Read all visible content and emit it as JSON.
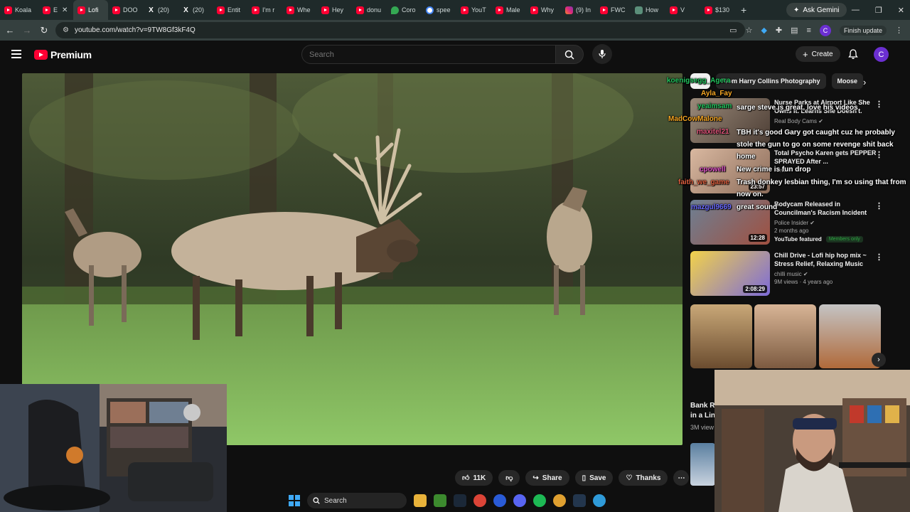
{
  "browser": {
    "tabs": [
      {
        "label": "Koala",
        "icon": "youtube-icon",
        "active": false
      },
      {
        "label": "E",
        "icon": "youtube-icon",
        "active": false
      },
      {
        "label": "Lofi",
        "icon": "youtube-icon",
        "active": true
      },
      {
        "label": "DOO",
        "icon": "youtube-icon",
        "active": false
      },
      {
        "label": "(20)",
        "icon": "x-icon",
        "active": false
      },
      {
        "label": "(20)",
        "icon": "x-icon",
        "active": false
      },
      {
        "label": "Entit",
        "icon": "youtube-icon",
        "active": false
      },
      {
        "label": "I'm r",
        "icon": "youtube-icon",
        "active": false
      },
      {
        "label": "Whe",
        "icon": "youtube-icon",
        "active": false
      },
      {
        "label": "Hey",
        "icon": "youtube-icon",
        "active": false
      },
      {
        "label": "donu",
        "icon": "youtube-icon",
        "active": false
      },
      {
        "label": "Coro",
        "icon": "maps-icon",
        "active": false
      },
      {
        "label": "spee",
        "icon": "google-icon",
        "active": false
      },
      {
        "label": "YouT",
        "icon": "youtube-icon",
        "active": false
      },
      {
        "label": "Male",
        "icon": "youtube-icon",
        "active": false
      },
      {
        "label": "Why",
        "icon": "youtube-icon",
        "active": false
      },
      {
        "label": "(9) In",
        "icon": "instagram-icon",
        "active": false
      },
      {
        "label": "FWC",
        "icon": "youtube-icon",
        "active": false
      },
      {
        "label": "How",
        "icon": "fwc-icon",
        "active": false
      },
      {
        "label": "V",
        "icon": "youtube-icon",
        "active": false
      },
      {
        "label": "$130",
        "icon": "youtube-icon",
        "active": false
      }
    ],
    "new_tab": "+",
    "ask_gemini": "Ask Gemini",
    "url": "youtube.com/watch?v=9TW8Gf3kF4Q",
    "finish_update": "Finish update",
    "profile_initial": "C"
  },
  "youtube": {
    "logo_text": "Premium",
    "search_placeholder": "Search",
    "create_label": "Create",
    "avatar_initial": "C",
    "chips": [
      "All",
      "From Harry Collins Photography",
      "Moose"
    ],
    "recommendations": [
      {
        "title": "Nurse Parks at Airport Like She Owns It. Learns She Doesn't.",
        "channel": "Real Body Cams",
        "meta": "",
        "duration": "",
        "featured": false,
        "members": false
      },
      {
        "title": "Total Psycho Karen gets PEPPER SPRAYED After ...",
        "channel": "",
        "meta": "New",
        "duration": "23:57",
        "featured": false,
        "members": false
      },
      {
        "title": "Bodycam Released in Councilman's Racism Incident",
        "channel": "Police Insider",
        "meta": "2 months ago",
        "duration": "12:28",
        "featured": true,
        "featured_label": "YouTube featured",
        "members": true,
        "members_label": "Members only"
      },
      {
        "title": "Chill Drive - Lofi hip hop mix ~ Stress Relief, Relaxing Music",
        "channel": "chilli music",
        "meta": "9M views · 4 years ago",
        "duration": "2:08:29",
        "featured": false,
        "members": false
      }
    ],
    "partial_title": "Bank R\nin a Lin",
    "partial_meta": "3M view",
    "actions": {
      "likes": "11K",
      "share": "Share",
      "save": "Save",
      "thanks": "Thanks"
    }
  },
  "chat": {
    "names": [
      {
        "name": "koenigsegg_Agera",
        "color": "#22c55e"
      },
      {
        "name": "Ayla_Fay",
        "color": "#f5a623"
      },
      {
        "name": "yeaimsam",
        "color": "#22c55e"
      },
      {
        "name": "MadCowMalone",
        "color": "#f5a623"
      },
      {
        "name": "maxitel21",
        "color": "#e0557a"
      },
      {
        "name": "cpowell",
        "color": "#e055c8"
      },
      {
        "name": "faith_we_game",
        "color": "#e06040"
      },
      {
        "name": "mazgul9669",
        "color": "#6a6aff"
      }
    ],
    "messages": [
      "sarge steve is great, love his videos",
      "TBH it's good Gary got caught cuz he probably stole the gun to go on some revenge shit back home",
      "New crime is fun drop",
      "Trash donkey lesbian thing, I'm so using that from now on.",
      "great sound"
    ]
  },
  "taskbar": {
    "search_label": "Search"
  }
}
